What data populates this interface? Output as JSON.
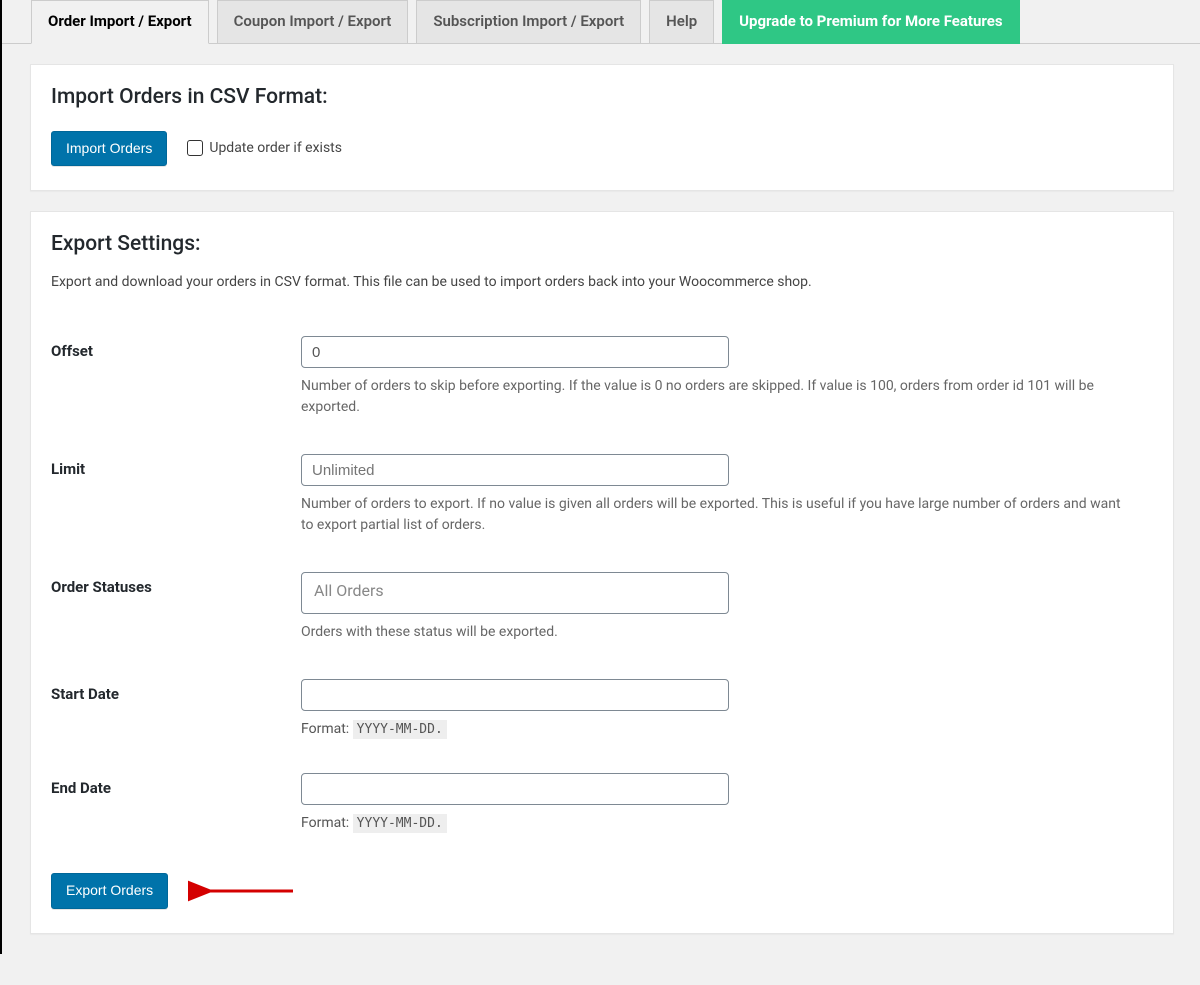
{
  "tabs": [
    {
      "label": "Order Import / Export",
      "active": true
    },
    {
      "label": "Coupon Import / Export",
      "active": false
    },
    {
      "label": "Subscription Import / Export",
      "active": false
    },
    {
      "label": "Help",
      "active": false
    },
    {
      "label": "Upgrade to Premium for More Features",
      "premium": true
    }
  ],
  "import": {
    "title": "Import Orders in CSV Format:",
    "button": "Import Orders",
    "checkbox_label": "Update order if exists"
  },
  "export": {
    "title": "Export Settings:",
    "description": "Export and download your orders in CSV format. This file can be used to import orders back into your Woocommerce shop.",
    "fields": {
      "offset": {
        "label": "Offset",
        "value": "0",
        "description": "Number of orders to skip before exporting. If the value is 0 no orders are skipped. If value is 100, orders from order id 101 will be exported."
      },
      "limit": {
        "label": "Limit",
        "placeholder": "Unlimited",
        "description": "Number of orders to export. If no value is given all orders will be exported. This is useful if you have large number of orders and want to export partial list of orders."
      },
      "order_statuses": {
        "label": "Order Statuses",
        "placeholder": "All Orders",
        "description": "Orders with these status will be exported."
      },
      "start_date": {
        "label": "Start Date",
        "format_prefix": "Format:",
        "format_code": "YYYY-MM-DD."
      },
      "end_date": {
        "label": "End Date",
        "format_prefix": "Format:",
        "format_code": "YYYY-MM-DD."
      }
    },
    "button": "Export Orders"
  }
}
